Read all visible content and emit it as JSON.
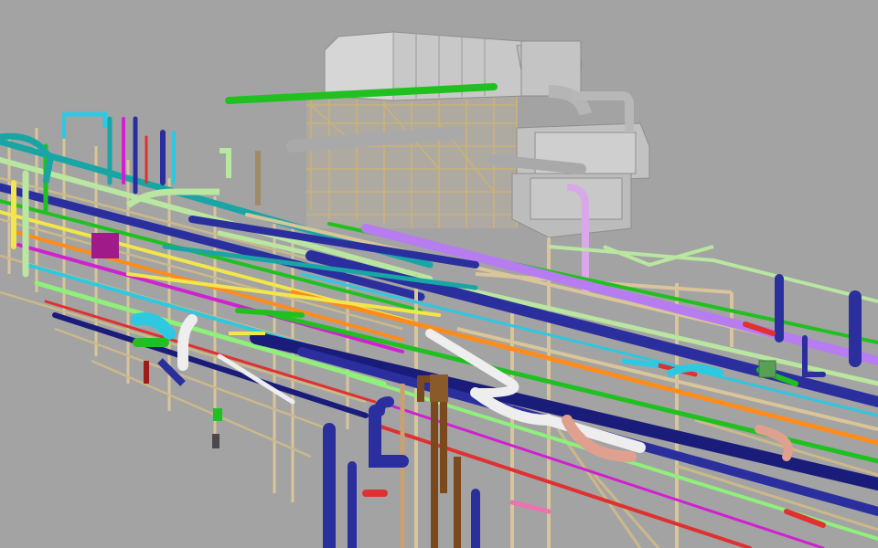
{
  "viewport": {
    "background": "#a3a3a3"
  },
  "palette": {
    "structure": "#d8c59a",
    "structure_dark": "#b8a276",
    "equipment_gray": "#c8c8c8",
    "equipment_shadow": "#8e8e8e",
    "pipe_blue": "#2b2f9e",
    "pipe_navy": "#1a1c7a",
    "pipe_purple": "#b77cf0",
    "pipe_green": "#20c020",
    "pipe_lime": "#8ff07a",
    "pipe_pale_green": "#b9e6a0",
    "pipe_teal": "#1aa5a5",
    "pipe_cyan": "#2ec8e0",
    "pipe_orange": "#ff8c1a",
    "pipe_yellow": "#f2e64a",
    "pipe_red": "#e03030",
    "pipe_pink": "#f070b0",
    "pipe_magenta": "#d020d0",
    "pipe_brown": "#7a4a1e",
    "pipe_tan": "#c9a070",
    "pipe_white": "#eeeeee",
    "pipe_salmon": "#e0a090"
  }
}
